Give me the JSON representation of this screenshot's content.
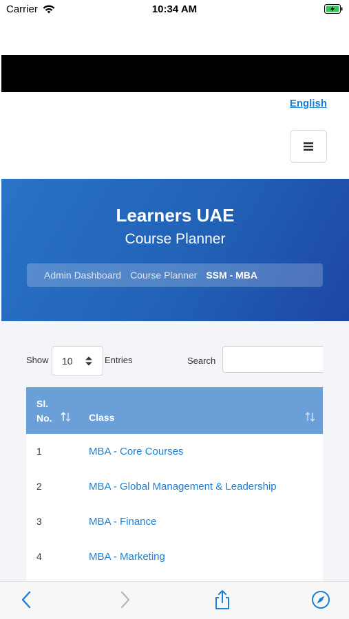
{
  "status_bar": {
    "carrier": "Carrier",
    "time": "10:34 AM",
    "icons": [
      "wifi-icon",
      "battery-charging-icon"
    ]
  },
  "header": {
    "language": "English",
    "menu_icon": "hamburger-menu-icon"
  },
  "hero": {
    "title": "Learners UAE",
    "subtitle": "Course Planner",
    "breadcrumbs": [
      "Admin Dashboard",
      "Course Planner",
      "SSM - MBA"
    ]
  },
  "table_controls": {
    "show_label": "Show",
    "entries_value": "10",
    "entries_label": "Entries",
    "search_label": "Search",
    "search_value": ""
  },
  "table": {
    "columns": [
      "Sl. No.",
      "Class"
    ],
    "rows": [
      {
        "no": "1",
        "class": "MBA - Core Courses"
      },
      {
        "no": "2",
        "class": "MBA - Global Management & Leadership"
      },
      {
        "no": "3",
        "class": "MBA - Finance"
      },
      {
        "no": "4",
        "class": "MBA - Marketing"
      }
    ]
  },
  "toolbar": {
    "icons": [
      "back-icon",
      "forward-icon",
      "share-icon",
      "compass-icon"
    ]
  },
  "colors": {
    "accent": "#1a7fd6",
    "hero_start": "#2a73c7",
    "hero_end": "#1d46a4",
    "table_header": "#6a9fd8"
  }
}
